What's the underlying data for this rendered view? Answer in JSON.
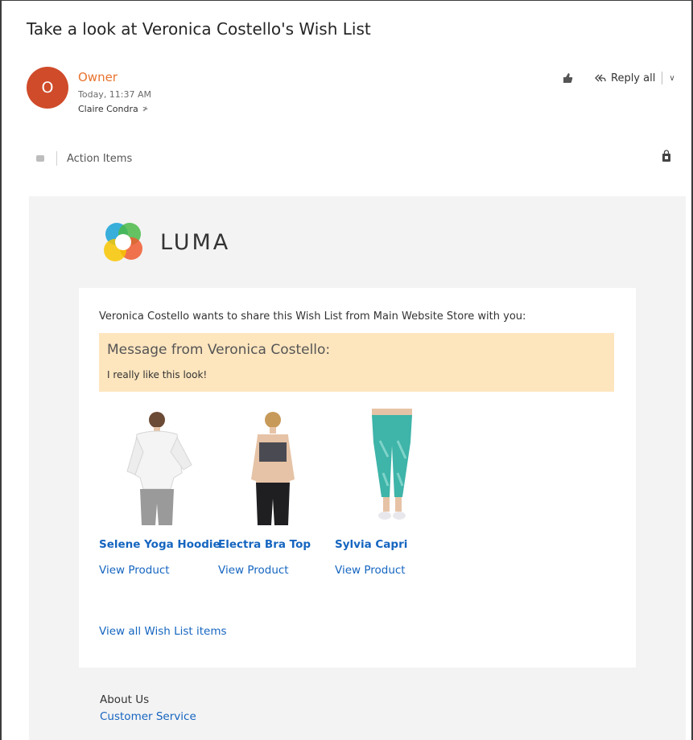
{
  "email": {
    "subject": "Take a look at Veronica Costello's Wish List",
    "avatar_initial": "O",
    "sender": "Owner",
    "time": "Today, 11:37 AM",
    "to": "Claire Condra",
    "reply_all_label": "Reply all",
    "action_items_label": "Action Items"
  },
  "store": {
    "logo_text": "LUMA",
    "intro": "Veronica Costello wants to share this Wish List from Main Website Store with you:",
    "message_title": "Message from Veronica Costello:",
    "message_body": "I really like this look!",
    "products": [
      {
        "name": "Selene Yoga Hoodie",
        "link": "View Product"
      },
      {
        "name": "Electra Bra Top",
        "link": "View Product"
      },
      {
        "name": "Sylvia Capri",
        "link": "View Product"
      }
    ],
    "view_all": "View all Wish List items",
    "footer": {
      "about": "About Us",
      "customer_service": "Customer Service"
    }
  },
  "colors": {
    "avatar": "#cf4b2a",
    "sender": "#e8732d",
    "link": "#1565c0",
    "message_box": "#fde5be",
    "canvas": "#f3f3f4"
  }
}
